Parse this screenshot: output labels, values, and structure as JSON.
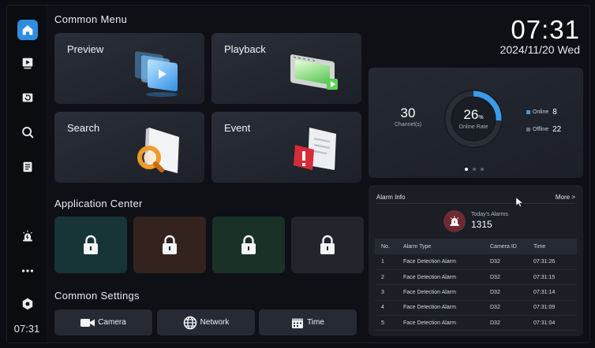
{
  "sidebar": {
    "items": [
      {
        "name": "home",
        "icon": "home-icon",
        "active": true
      },
      {
        "name": "preview",
        "icon": "play-icon"
      },
      {
        "name": "playback",
        "icon": "playback-icon"
      },
      {
        "name": "search",
        "icon": "search-icon"
      },
      {
        "name": "event",
        "icon": "document-icon"
      },
      {
        "name": "alarm",
        "icon": "alarm-light-icon"
      },
      {
        "name": "more",
        "icon": "more-icon"
      },
      {
        "name": "settings",
        "icon": "settings-icon"
      }
    ],
    "clock": "07:31"
  },
  "common_menu": {
    "title": "Common  Menu",
    "tiles": [
      "Preview",
      "Playback",
      "Search",
      "Event"
    ]
  },
  "application_center": {
    "title": "Application  Center",
    "tile_colors": [
      "#173437",
      "#33221e",
      "#1a3127",
      "#24252c"
    ]
  },
  "common_settings": {
    "title": "Common  Settings",
    "buttons": [
      "Camera",
      "Network",
      "Time"
    ]
  },
  "header": {
    "time": "07:31",
    "date": "2024/11/20  Wed"
  },
  "status": {
    "channels": "30",
    "channels_label": "Channel(s)",
    "online_rate": "26",
    "online_rate_unit": "%",
    "online_rate_value": 0.26,
    "online_rate_label": "Online  Rate",
    "online_label": "Online",
    "online_count": "8",
    "offline_label": "Offline",
    "offline_count": "22",
    "colors": {
      "online": "#3a9be8",
      "offline": "#6b6f78"
    }
  },
  "alarm_info": {
    "title": "Alarm  Info",
    "more": "More  >",
    "todays_label": "Today's  Alarms",
    "todays_count": "1315",
    "columns": [
      "No.",
      "Alarm  Type",
      "Camera  ID",
      "Time"
    ],
    "rows": [
      [
        "1",
        "Face  Detection  Alarm",
        "D32",
        "07:31:26"
      ],
      [
        "2",
        "Face  Detection  Alarm",
        "D32",
        "07:31:15"
      ],
      [
        "3",
        "Face  Detection  Alarm",
        "D32",
        "07:31:14"
      ],
      [
        "4",
        "Face  Detection  Alarm",
        "D32",
        "07:31:09"
      ],
      [
        "5",
        "Face  Detection  Alarm",
        "D32",
        "07:31:04"
      ]
    ]
  }
}
